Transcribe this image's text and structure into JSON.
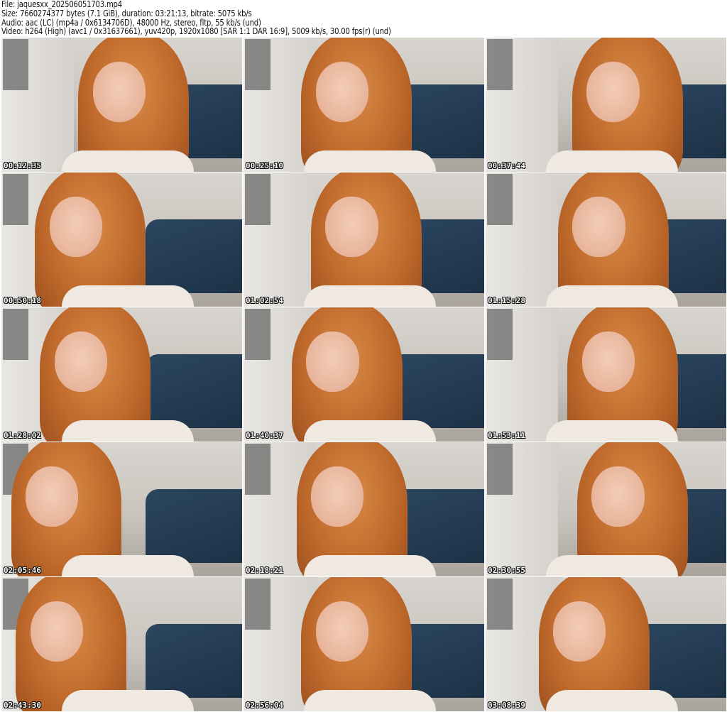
{
  "header": {
    "file": "File: jaquesxx_202506051703.mp4",
    "size": "Size: 7660274377 bytes (7.1 GiB), duration: 03:21:13, bitrate: 5075 kb/s",
    "audio": "Audio: aac (LC) (mp4a / 0x6134706D), 48000 Hz, stereo, fltp, 55 kb/s (und)",
    "video": "Video: h264 (High) (avc1 / 0x31637661), yuv420p, 1920x1080 [SAR 1:1 DAR 16:9], 5009 kb/s, 30.00 fps(r) (und)"
  },
  "thumbnails": [
    {
      "timestamp": "00:12:35"
    },
    {
      "timestamp": "00:25:10"
    },
    {
      "timestamp": "00:37:44"
    },
    {
      "timestamp": "00:50:18"
    },
    {
      "timestamp": "01:02:54"
    },
    {
      "timestamp": "01:15:28"
    },
    {
      "timestamp": "01:28:02"
    },
    {
      "timestamp": "01:40:37"
    },
    {
      "timestamp": "01:53:11"
    },
    {
      "timestamp": "02:05:46"
    },
    {
      "timestamp": "02:18:21"
    },
    {
      "timestamp": "02:30:55"
    },
    {
      "timestamp": "02:43:30"
    },
    {
      "timestamp": "02:56:04"
    },
    {
      "timestamp": "03:08:39"
    }
  ]
}
